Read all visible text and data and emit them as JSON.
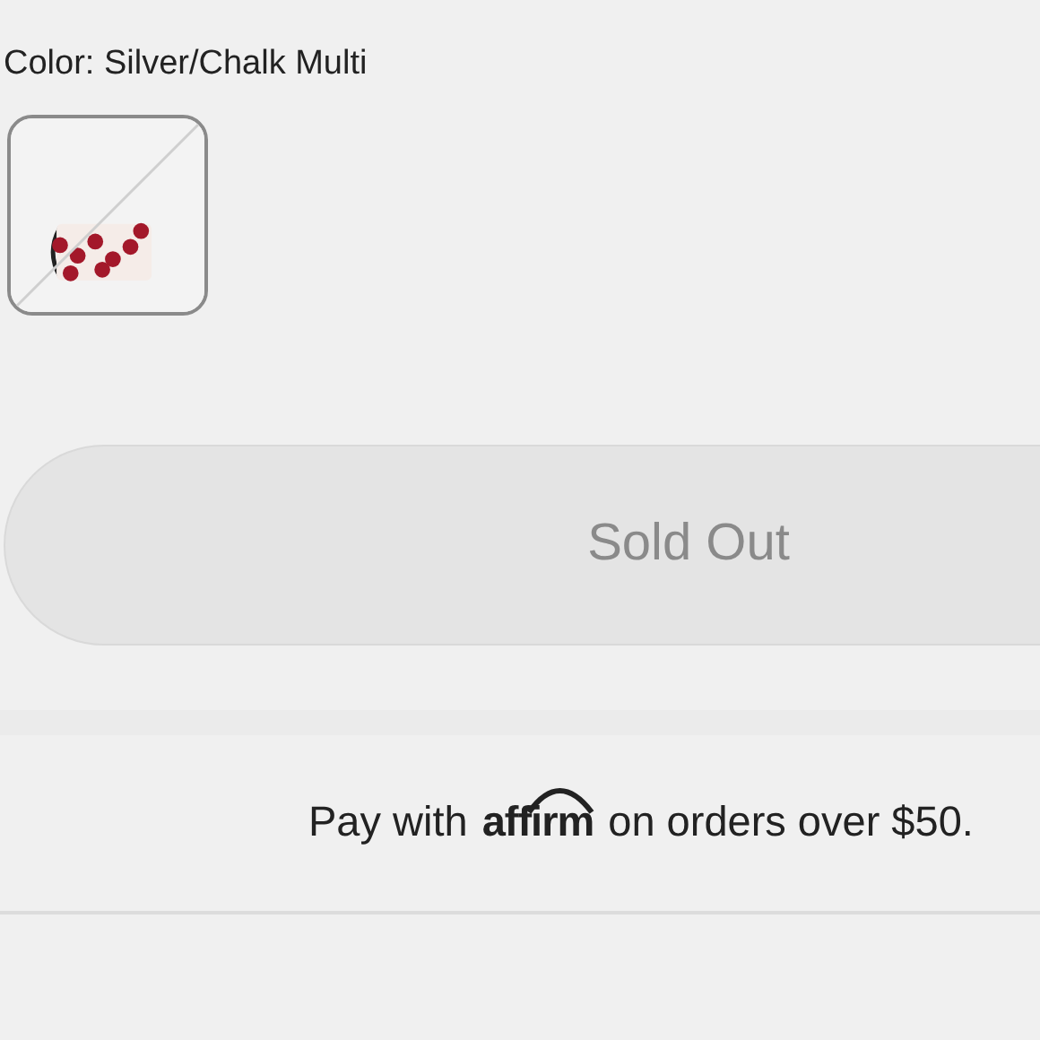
{
  "color_label": "Color: Silver/Chalk Multi",
  "swatches": [
    {
      "kind": "picture",
      "selected": true,
      "unavailable": true
    }
  ],
  "add_button": {
    "label": "Sold Out",
    "disabled": true
  },
  "financing": {
    "before": "Pay with",
    "brand": "affirm",
    "after": "on orders over $50."
  }
}
